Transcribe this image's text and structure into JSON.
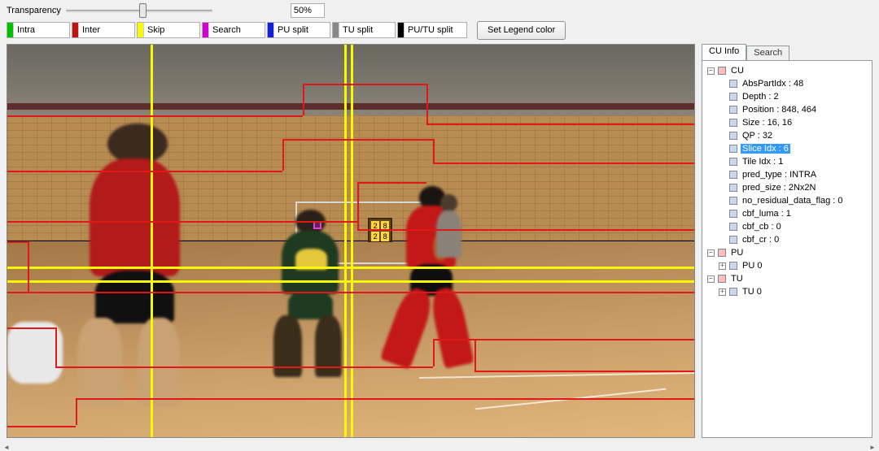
{
  "toolbar": {
    "transparency_label": "Transparency",
    "transparency_value": "50%",
    "slider_pct": 50,
    "set_legend_button": "Set Legend color"
  },
  "legend": [
    {
      "label": "Intra",
      "color": "#00c000"
    },
    {
      "label": "Inter",
      "color": "#c01414"
    },
    {
      "label": "Skip",
      "color": "#f8f800"
    },
    {
      "label": "Search",
      "color": "#d000d0"
    },
    {
      "label": "PU split",
      "color": "#1420d8"
    },
    {
      "label": "TU split",
      "color": "#888888"
    },
    {
      "label": "PU/TU split",
      "color": "#000000"
    }
  ],
  "tabs": {
    "active": "CU Info",
    "inactive": "Search"
  },
  "tree": {
    "cu": {
      "label": "CU",
      "items": [
        "AbsPartIdx : 48",
        "Depth : 2",
        "Position : 848, 464",
        "Size : 16, 16",
        "QP : 32",
        "Slice Idx : 6",
        "Tile Idx : 1",
        "pred_type : INTRA",
        "pred_size : 2Nx2N",
        "no_residual_data_flag : 0",
        "cbf_luma : 1",
        "cbf_cb : 0",
        "cbf_cr : 0"
      ],
      "selected_index": 5
    },
    "pu": {
      "label": "PU",
      "items": [
        "PU 0"
      ]
    },
    "tu": {
      "label": "TU",
      "items": [
        "TU 0"
      ]
    }
  },
  "colors": {
    "yellow": "#f8f800",
    "red": "#e01818"
  }
}
